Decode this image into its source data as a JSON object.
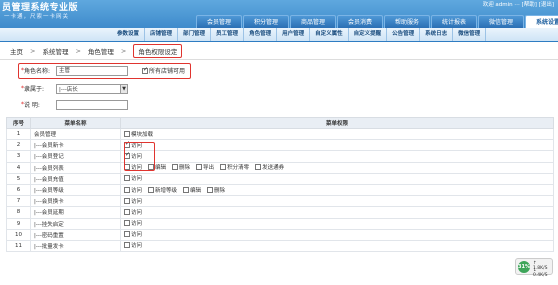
{
  "header": {
    "brand": "员管理系统专业版",
    "slogan": "一卡通，尺索一卡网关",
    "userinfo": "欢迎 admin  ⋯  [帮助] [退出]"
  },
  "main_tabs": [
    "会员管理",
    "积分管理",
    "商品管理",
    "会员消费",
    "帮助服务",
    "统计报表",
    "微信管理",
    "系统设置"
  ],
  "sub_nav": [
    "参数设置",
    "店铺管理",
    "部门管理",
    "员工管理",
    "角色管理",
    "用户管理",
    "自定义属性",
    "自定义提醒",
    "公告管理",
    "系统日志",
    "微信管理"
  ],
  "breadcrumb": [
    "主页",
    "系统管理",
    "角色管理",
    "角色权限设定"
  ],
  "form": {
    "role_name_label": "角色名称:",
    "role_name_value": "主管",
    "all_shops_label": "所有店铺可用",
    "belongs_label": "隶属于:",
    "belongs_value": "|---店长",
    "note_label": "说    明:"
  },
  "table": {
    "headers": [
      "序号",
      "菜单名称",
      "菜单权限"
    ],
    "rows": [
      {
        "num": "1",
        "name": "会员管理",
        "perms": [
          {
            "label": "模块加载",
            "checked": false
          }
        ]
      },
      {
        "num": "2",
        "name": "|---会员新卡",
        "perms": [
          {
            "label": "访问",
            "checked": true
          }
        ]
      },
      {
        "num": "3",
        "name": "|---会员登记",
        "perms": [
          {
            "label": "访问",
            "checked": true
          }
        ]
      },
      {
        "num": "4",
        "name": "|---会员列表",
        "perms": [
          {
            "label": "访问",
            "checked": false
          },
          {
            "label": "编辑",
            "checked": false
          },
          {
            "label": "删除",
            "checked": false
          },
          {
            "label": "导出",
            "checked": false
          },
          {
            "label": "积分清零",
            "checked": false
          },
          {
            "label": "发送通券",
            "checked": false
          }
        ]
      },
      {
        "num": "5",
        "name": "|---会员充值",
        "perms": [
          {
            "label": "访问",
            "checked": false
          }
        ]
      },
      {
        "num": "6",
        "name": "|---会员等级",
        "perms": [
          {
            "label": "访问",
            "checked": false
          },
          {
            "label": "新增等级",
            "checked": false
          },
          {
            "label": "编辑",
            "checked": false
          },
          {
            "label": "删除",
            "checked": false
          }
        ]
      },
      {
        "num": "7",
        "name": "|---会员换卡",
        "perms": [
          {
            "label": "访问",
            "checked": false
          }
        ]
      },
      {
        "num": "8",
        "name": "|---会员延期",
        "perms": [
          {
            "label": "访问",
            "checked": false
          }
        ]
      },
      {
        "num": "9",
        "name": "|---挂失启定",
        "perms": [
          {
            "label": "访问",
            "checked": false
          }
        ]
      },
      {
        "num": "10",
        "name": "|---密码重置",
        "perms": [
          {
            "label": "访问",
            "checked": false
          }
        ]
      },
      {
        "num": "11",
        "name": "|---批量发卡",
        "perms": [
          {
            "label": "访问",
            "checked": false
          }
        ]
      }
    ]
  },
  "speed": {
    "percent": "31%",
    "up": "↑ 1.8K/S",
    "down": "↓ 0.4K/S"
  }
}
